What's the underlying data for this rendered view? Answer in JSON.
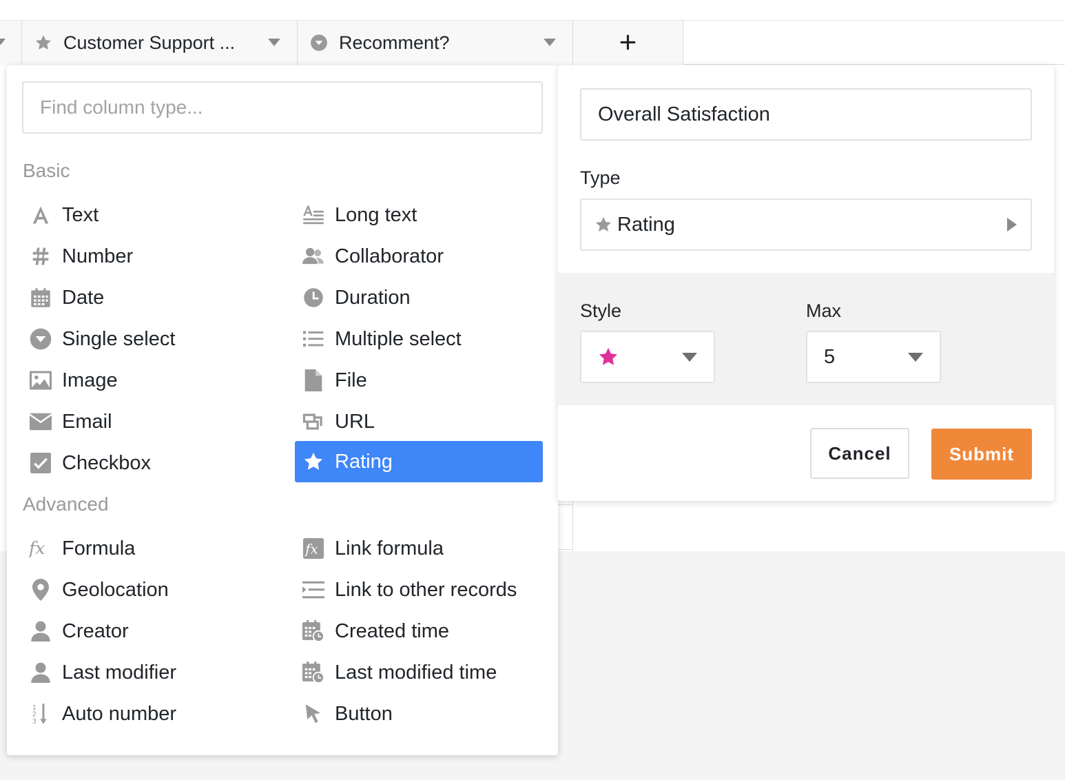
{
  "header": {
    "columns": [
      {
        "label": "Customer Support ...",
        "icon": "star-icon"
      },
      {
        "label": "Recomment?",
        "icon": "single-select-icon"
      }
    ],
    "add_column_label": "+"
  },
  "type_menu": {
    "search_placeholder": "Find column type...",
    "sections": {
      "basic": "Basic",
      "advanced": "Advanced"
    },
    "basic_items": [
      {
        "label": "Text",
        "icon": "text-icon"
      },
      {
        "label": "Long text",
        "icon": "long-text-icon"
      },
      {
        "label": "Number",
        "icon": "number-icon"
      },
      {
        "label": "Collaborator",
        "icon": "collaborator-icon"
      },
      {
        "label": "Date",
        "icon": "date-icon"
      },
      {
        "label": "Duration",
        "icon": "duration-icon"
      },
      {
        "label": "Single select",
        "icon": "single-select-icon"
      },
      {
        "label": "Multiple select",
        "icon": "multiple-select-icon"
      },
      {
        "label": "Image",
        "icon": "image-icon"
      },
      {
        "label": "File",
        "icon": "file-icon"
      },
      {
        "label": "Email",
        "icon": "email-icon"
      },
      {
        "label": "URL",
        "icon": "url-icon"
      },
      {
        "label": "Checkbox",
        "icon": "checkbox-icon"
      },
      {
        "label": "Rating",
        "icon": "star-icon",
        "selected": true
      }
    ],
    "advanced_items": [
      {
        "label": "Formula",
        "icon": "formula-icon"
      },
      {
        "label": "Link formula",
        "icon": "link-formula-icon"
      },
      {
        "label": "Geolocation",
        "icon": "geolocation-icon"
      },
      {
        "label": "Link to other records",
        "icon": "link-records-icon"
      },
      {
        "label": "Creator",
        "icon": "creator-icon"
      },
      {
        "label": "Created time",
        "icon": "created-time-icon"
      },
      {
        "label": "Last modifier",
        "icon": "last-modifier-icon"
      },
      {
        "label": "Last modified time",
        "icon": "last-modified-time-icon"
      },
      {
        "label": "Auto number",
        "icon": "auto-number-icon"
      },
      {
        "label": "Button",
        "icon": "button-cursor-icon"
      }
    ],
    "selected_color": "#3f86f8"
  },
  "editor": {
    "column_name": "Overall Satisfaction",
    "type_label": "Type",
    "type_value": "Rating",
    "style_label": "Style",
    "style_icon": "star-icon",
    "style_color": "#e0309c",
    "max_label": "Max",
    "max_value": "5",
    "cancel_label": "Cancel",
    "submit_label": "Submit",
    "submit_color": "#f0883a"
  }
}
